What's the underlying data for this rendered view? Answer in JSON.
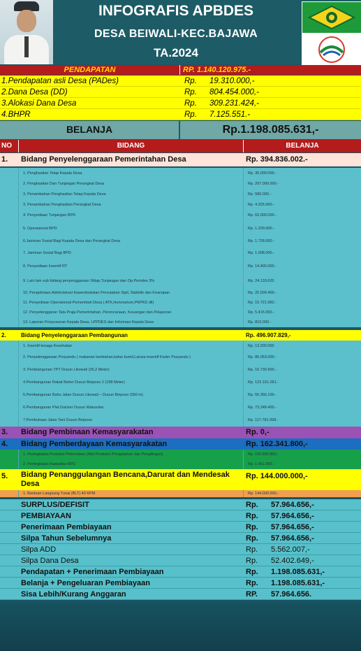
{
  "header": {
    "title": "INFOGRAFIS APBDES",
    "subtitle": "DESA BEIWALI-KEC.BAJAWA",
    "year": "TA.2024"
  },
  "pendapatan": {
    "label": "PENDAPATAN",
    "total": "RP. 1.140.120.975.-",
    "items": [
      {
        "label": "1.Pendapatan asli Desa (PADes)",
        "prefix": "Rp.",
        "value": "19.310.000,-"
      },
      {
        "label": "2.Dana Desa (DD)",
        "prefix": "Rp.",
        "value": "804.454.000,-"
      },
      {
        "label": "3.Alokasi Dana Desa",
        "prefix": "Rp.",
        "value": "309.231.424,-"
      },
      {
        "label": "4.BHPR",
        "prefix": "Rp.",
        "value": "7.125.551.-"
      }
    ]
  },
  "belanja": {
    "label": "BELANJA",
    "total": "Rp.1.198.085.631,-"
  },
  "table": {
    "col_no": "NO",
    "col_bidang": "BIDANG",
    "col_belanja": "BELANJA"
  },
  "bidang1": {
    "no": "1.",
    "name": "Bidang Penyelenggaraan Pemerintahan Desa",
    "value": "Rp. 394.836.002.-",
    "items": [
      {
        "label": "1. Penghasilan Tetap Kepala Desa",
        "value": "Rp.     30.000.000.-"
      },
      {
        "label": "2. Penghasilan Dan Tunjangan Perangkat Desa",
        "value": "Rp.     207.000.000.-"
      },
      {
        "label": "3. Penambahan Penghasilan Tetap Kepala Desa",
        "value": "Rp.       580.000.-"
      },
      {
        "label": "3. Penambahan Penghasilan Perangkat Desa",
        "value": "Rp.     4.325.000.-"
      },
      {
        "label": "4. Penyediaan Tunjangan BPD",
        "value": "Rp.    63.000.000.-"
      },
      {
        "label": "5. Operasional BPD",
        "value": "Rp.     1.200.000.-"
      },
      {
        "label": "6.Jaminan Sosial Bagi Kepala Desa dan Perangkat Desa",
        "value": "Rp.     1.728.000.-"
      },
      {
        "label": "7. Jaminan Sosial Bagi BPD",
        "value": "Rp.     1.008.000.-"
      },
      {
        "label": "8. Penyediaan Insentif RT",
        "value": "Rp.    14.400.000.-"
      },
      {
        "label": "9. Lain lain sub bidang penyenggaraan Siltap,Tunjangan dan Op.Pemdes 3%",
        "value": "Rp.    24.133.620"
      },
      {
        "label": "10. Pengelolaan Administrasi Kependudukan Pencatatan Sipil, Statistik dan Kearsipan",
        "value": "Rp.    25.509.400.-"
      },
      {
        "label": "11. Penyediaan Operasional Pemerintah Desa ( ATK,Honorarium,PKPKD dll)",
        "value": "Rp.    15.721.982.-"
      },
      {
        "label": "12. Penyelenggaran Tata Praja Pemerintahan, Perencanaan, Keuangan dan Pelaporan",
        "value": "Rp.     5.415.000.-"
      },
      {
        "label": "13. Laporan Penyusunan Kepala Desa, LPPDES dan Informasi Kepala Desa",
        "value": "Rp.       810.000.-"
      }
    ]
  },
  "bidang2": {
    "no": "2.",
    "name": "Bidang Penyelenggaraan Pembangunan",
    "value": "Rp. 496.907.829,-",
    "items": [
      {
        "label": "1. Insentif tenaga Kesehatan",
        "value": "Rp.    13.200.000"
      },
      {
        "label": "2. Penyelenggaraan Posyandu ( makanan tambahan,kelas bumil,Lansia insentif Kader Posyandu )",
        "value": "Rp.    86.053.000.-"
      },
      {
        "label": "3. Pembangunan TPT Dusun Likowali (26,2 Meter)",
        "value": "Rp.    16.730.900.-"
      },
      {
        "label": "4.Pembangunan Rabat Beton Dusun Beiposo 2 (198 Meter)",
        "value": "Rp.   122.151.281.-"
      },
      {
        "label": "5.Pembangunan Bahu Jalan Dusun Likowali – Dusun Beiposo (550 m)",
        "value": "Rp.    55.356.100.-"
      },
      {
        "label": "6.Pembangunan Plat Duicker Dusun Watusoba",
        "value": "Rp.    73.248.400.-"
      },
      {
        "label": "7.Pembukaan Jalan Tani Dusun Beiposo",
        "value": "Rp.   117.781.098.-"
      },
      {
        "label": "8.Pembangunan/Rehabilitas/Peningkatan Sumber  Air Bersih Milik Desa",
        "value": "Rp.    11.980.800.-"
      },
      {
        "label": "9.Penyelenggaraan Informasi Publik Milik Desa",
        "value": "Rp.       406.250.-"
      }
    ]
  },
  "bidang3": {
    "no": "3.",
    "name": "Bidang Pembinaan Kemasyarakatan",
    "value": "Rp. 0,-"
  },
  "bidang4": {
    "no": "4.",
    "name": "Bidang Pemberdayaan Kemasyarakatan",
    "value": "Rp. 162.341.800,-",
    "items": [
      {
        "label": "1. Peningkatan Produksi Peternakan (Alat Produksi /Pengolahan dan Pengilingan)",
        "value": "Rp.   160.890.800,-"
      },
      {
        "label": "2. Peningkatan Kapasitas BPD",
        "value": "Rp.     1.451.000.-"
      }
    ]
  },
  "bidang5": {
    "no": "5.",
    "name_line1": "Bidang Penanggulangan Bencana,Darurat dan Mendesak",
    "name_line2": "Desa",
    "value": "Rp. 144.000.000,-",
    "items": [
      {
        "label": "1. Bantuan Langsung Tunai (BLT) 40 KPM",
        "value": "Rp.   144.000.000,-"
      }
    ]
  },
  "summary": [
    {
      "label": "SURPLUS/DEFISIT",
      "prefix": "Rp.",
      "value": "57.964.656,-",
      "bold": true
    },
    {
      "label": "PEMBIAYAAN",
      "prefix": "Rp.",
      "value": "57.964.656,-",
      "bold": true
    },
    {
      "label": "Penerimaan Pembiayaan",
      "prefix": "Rp.",
      "value": "57.964.656,-",
      "bold": true
    },
    {
      "label": "Silpa Tahun Sebelumnya",
      "prefix": "Rp.",
      "value": "57.964.656,-",
      "bold": true
    },
    {
      "label": "Silpa ADD",
      "prefix": "Rp.",
      "value": "5.562.007,-",
      "bold": false
    },
    {
      "label": "Silpa Dana Desa",
      "prefix": "Rp.",
      "value": "52.402.649,-",
      "bold": false
    },
    {
      "label": "Pendapatan + Penerimaan Pembiayaan",
      "prefix": "Rp.",
      "value": "1.198.085.631,-",
      "bold": true
    },
    {
      "label": "Belanja + Pengeluaran Pembiayaan",
      "prefix": "Rp.",
      "value": "1.198.085.631,-",
      "bold": true
    },
    {
      "label": "Sisa Lebih/Kurang Anggaran",
      "prefix": "RP.",
      "value": "57.964.656.",
      "bold": true
    }
  ],
  "colors": {
    "header_bg": "#1d5c66",
    "red": "#b41c1c",
    "yellow": "#ffff00",
    "teal": "#5bc0cc",
    "purple": "#9a52b4",
    "blue": "#1b6ec0",
    "green": "#17a04a",
    "orange": "#f0a050"
  }
}
